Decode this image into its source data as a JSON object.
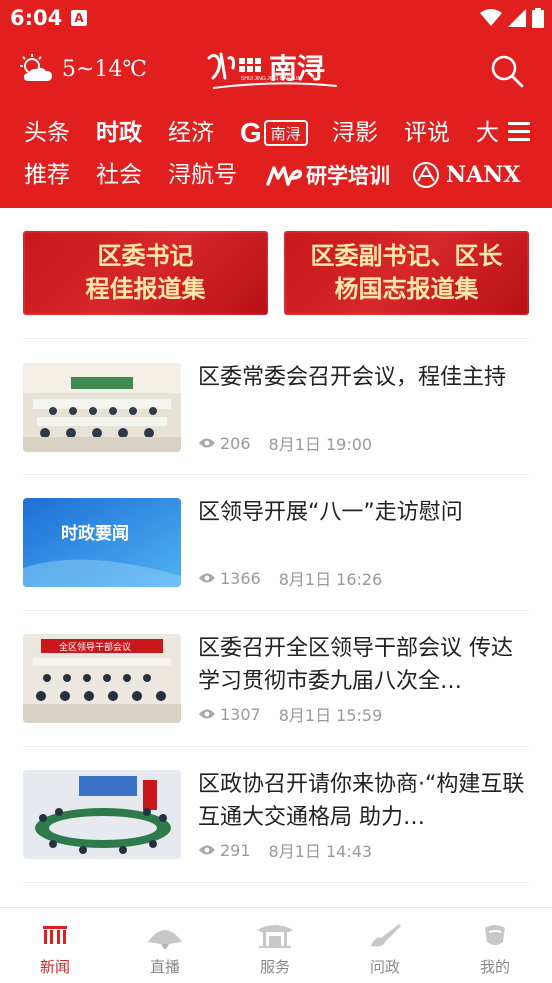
{
  "status_bar": {
    "time": "6:04",
    "a_badge": "A"
  },
  "header": {
    "weather": "5~14℃",
    "nav_row1": [
      "头条",
      "时政",
      "经济",
      "G",
      "南浔",
      "浔影",
      "评说",
      "大"
    ],
    "nav_row2": [
      "推荐",
      "社会",
      "浔航号",
      "研学培训",
      "NANX"
    ],
    "logo_text": "南浔",
    "logo_small": "SHUI JING JING NANXUN"
  },
  "banners": [
    {
      "line1": "区委书记",
      "line2": "程佳报道集"
    },
    {
      "line1": "区委副书记、区长",
      "line2": "杨国志报道集"
    }
  ],
  "articles": [
    {
      "title": "区委常委会召开会议，程佳主持",
      "views": "206",
      "time": "8月1日 19:00"
    },
    {
      "title": "区领导开展“八一”走访慰问",
      "views": "1366",
      "time": "8月1日 16:26",
      "thumb_text": "时政要闻"
    },
    {
      "title": "区委召开全区领导干部会议 传达学习贯彻市委九届八次全…",
      "views": "1307",
      "time": "8月1日 15:59",
      "thumb_text": "全区领导干部会议"
    },
    {
      "title": "区政协召开请你来协商·“构建互联互通大交通格局 助力…",
      "views": "291",
      "time": "8月1日 14:43"
    }
  ],
  "bottom_nav": [
    "新闻",
    "直播",
    "服务",
    "问政",
    "我的"
  ],
  "colors": {
    "brand_red": "#e21f1f",
    "banner_text": "#ffe9a8",
    "meta_gray": "#9a9a9a"
  }
}
